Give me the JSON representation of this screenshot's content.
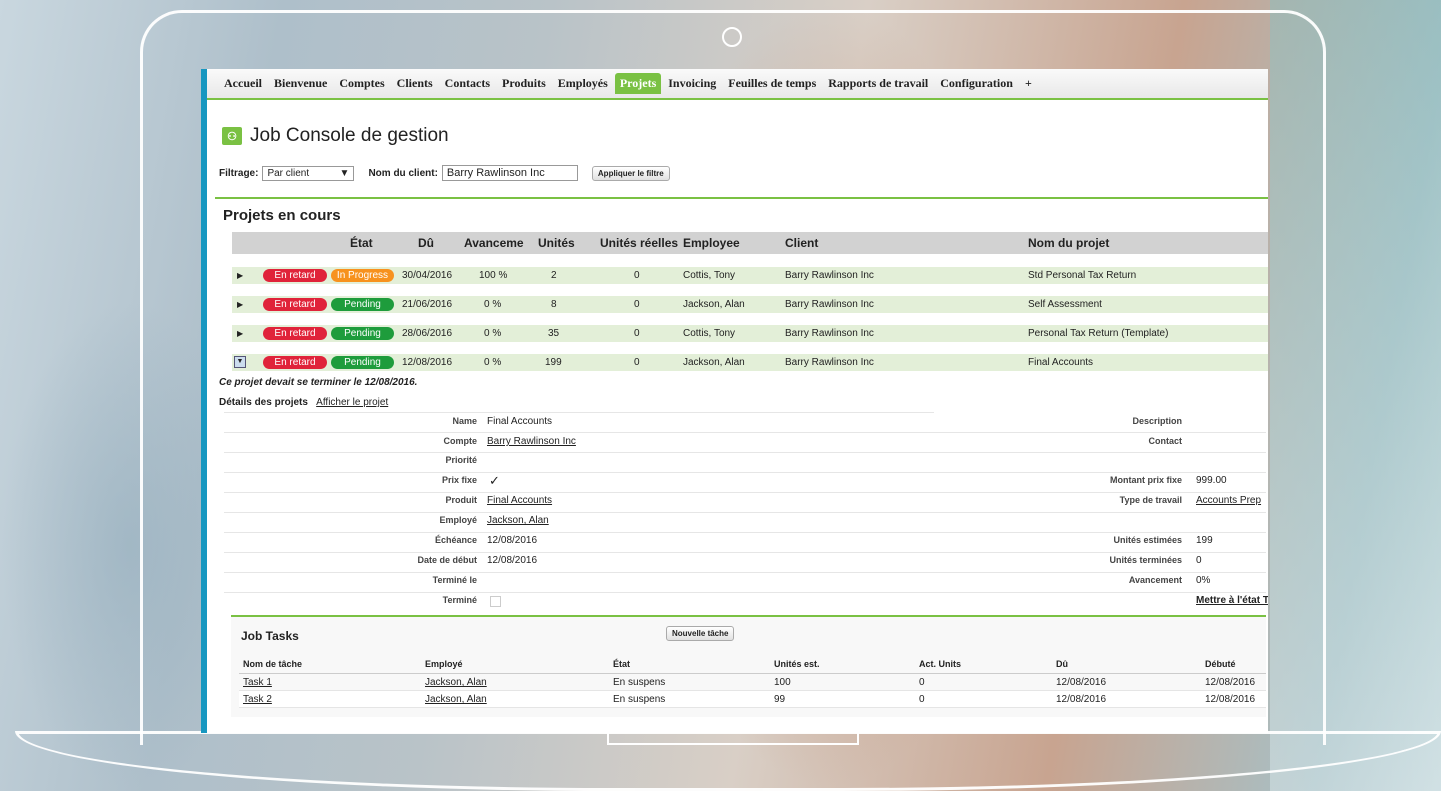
{
  "nav": [
    "Accueil",
    "Bienvenue",
    "Comptes",
    "Clients",
    "Contacts",
    "Produits",
    "Employés",
    "Projets",
    "Invoicing",
    "Feuilles de temps",
    "Rapports de travail",
    "Configuration",
    "+"
  ],
  "nav_active": "Projets",
  "page_title": "Job Console de gestion",
  "filter": {
    "label": "Filtrage:",
    "selected": "Par client",
    "client_label": "Nom du client:",
    "client_value": "Barry Rawlinson Inc",
    "apply": "Appliquer le filtre"
  },
  "section_title": "Projets en cours",
  "columns": [
    "État",
    "Dû",
    "Avanceme",
    "Unités",
    "Unités réelles",
    "Employee",
    "Client",
    "Nom du projet"
  ],
  "projects": [
    {
      "late": "En retard",
      "status": "In Progress",
      "due": "30/04/2016",
      "progress": "100 %",
      "units": "2",
      "actual": "0",
      "employee": "Cottis, Tony",
      "client": "Barry Rawlinson Inc",
      "name": "Std Personal Tax Return"
    },
    {
      "late": "En retard",
      "status": "Pending",
      "due": "21/06/2016",
      "progress": "0 %",
      "units": "8",
      "actual": "0",
      "employee": "Jackson, Alan",
      "client": "Barry Rawlinson Inc",
      "name": "Self Assessment"
    },
    {
      "late": "En retard",
      "status": "Pending",
      "due": "28/06/2016",
      "progress": "0 %",
      "units": "35",
      "actual": "0",
      "employee": "Cottis, Tony",
      "client": "Barry Rawlinson Inc",
      "name": "Personal Tax Return (Template)"
    },
    {
      "late": "En retard",
      "status": "Pending",
      "due": "12/08/2016",
      "progress": "0 %",
      "units": "199",
      "actual": "0",
      "employee": "Jackson, Alan",
      "client": "Barry Rawlinson Inc",
      "name": "Final Accounts"
    }
  ],
  "warning": "Ce projet devait se terminer le 12/08/2016.",
  "details": {
    "title": "Détails des projets",
    "view_link": "Afficher le projet",
    "left": [
      {
        "label": "Name",
        "value": "Final Accounts"
      },
      {
        "label": "Compte",
        "value": "Barry Rawlinson Inc"
      },
      {
        "label": "Priorité",
        "value": ""
      },
      {
        "label": "Prix fixe",
        "value": "✓"
      },
      {
        "label": "Produit",
        "value": "Final Accounts"
      },
      {
        "label": "Employé",
        "value": "Jackson, Alan"
      },
      {
        "label": "Échéance",
        "value": "12/08/2016"
      },
      {
        "label": "Date de début",
        "value": "12/08/2016"
      },
      {
        "label": "Terminé le",
        "value": ""
      },
      {
        "label": "Terminé",
        "value": ""
      }
    ],
    "right": [
      {
        "label": "Description",
        "value": ""
      },
      {
        "label": "Contact",
        "value": ""
      },
      {
        "label": "",
        "value": ""
      },
      {
        "label": "Montant prix fixe",
        "value": "999.00"
      },
      {
        "label": "Type de travail",
        "value": "Accounts Prep"
      },
      {
        "label": "",
        "value": ""
      },
      {
        "label": "Unités estimées",
        "value": "199"
      },
      {
        "label": "Unités terminées",
        "value": "0"
      },
      {
        "label": "Avancement",
        "value": "0%"
      },
      {
        "label": "",
        "value": "Mettre à l'état Te"
      }
    ]
  },
  "tasks": {
    "title": "Job Tasks",
    "new_button": "Nouvelle tâche",
    "columns": [
      "Nom de tâche",
      "Employé",
      "État",
      "Unités est.",
      "Act. Units",
      "Dû",
      "Débuté"
    ],
    "rows": [
      [
        "Task 1",
        "Jackson, Alan",
        "En suspens",
        "100",
        "0",
        "12/08/2016",
        "12/08/2016"
      ],
      [
        "Task 2",
        "Jackson, Alan",
        "En suspens",
        "99",
        "0",
        "12/08/2016",
        "12/08/2016"
      ]
    ]
  },
  "colors": {
    "accent": "#7ac143",
    "late": "#e0233a",
    "in_progress": "#f7921e",
    "pending": "#1e9c3c",
    "sidebar": "#1797c0"
  }
}
